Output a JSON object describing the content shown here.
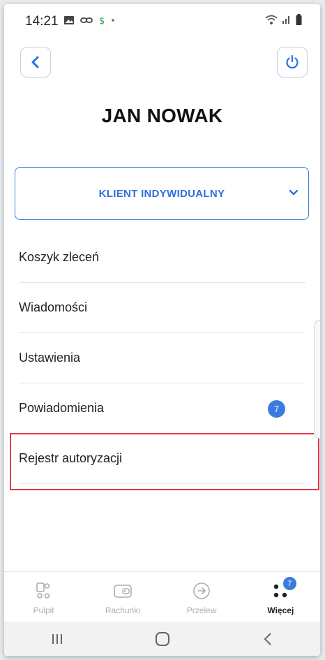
{
  "status_bar": {
    "time": "14:21"
  },
  "header": {
    "back_icon": "chevron-left-icon",
    "power_icon": "power-icon",
    "user_name": "JAN NOWAK"
  },
  "client_select": {
    "label": "KLIENT INDYWIDUALNY",
    "icon": "chevron-down-icon"
  },
  "menu": {
    "items": [
      {
        "label": "Koszyk zleceń"
      },
      {
        "label": "Wiadomości"
      },
      {
        "label": "Ustawienia"
      },
      {
        "label": "Powiadomienia",
        "badge": "7"
      },
      {
        "label": "Rejestr autoryzacji",
        "highlighted": true
      }
    ]
  },
  "bottom_nav": {
    "items": [
      {
        "label": "Pulpit",
        "icon": "dashboard-icon",
        "active": false
      },
      {
        "label": "Rachunki",
        "icon": "wallet-icon",
        "active": false
      },
      {
        "label": "Przelew",
        "icon": "transfer-arrow-icon",
        "active": false
      },
      {
        "label": "Więcej",
        "icon": "more-dots-icon",
        "active": true,
        "badge": "7"
      }
    ]
  },
  "colors": {
    "accent": "#3a7be0",
    "highlight_border": "#e03a45",
    "inactive": "#a9adb3"
  }
}
